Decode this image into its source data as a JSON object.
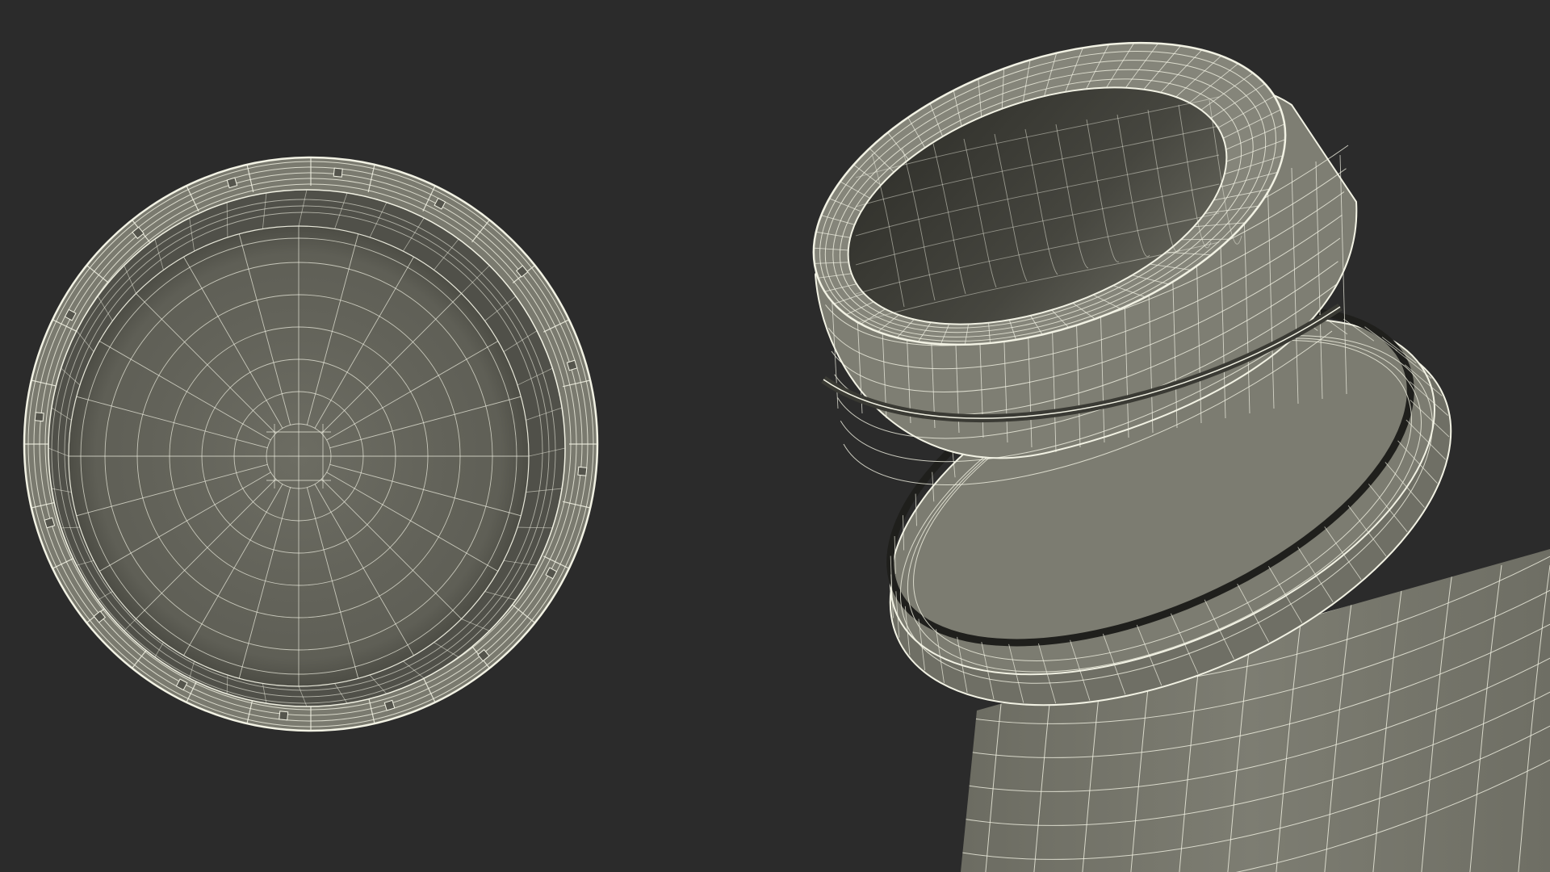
{
  "colors": {
    "background": "#2b2b2b",
    "mesh_fill": "#77776c",
    "mesh_fill_light": "#8a8a7e",
    "mesh_fill_dark": "#4f4f47",
    "interior_dark": "#3a3a34",
    "wire": "#f2f2e4"
  },
  "objects": [
    {
      "name": "bottle-cap-wireframe",
      "view": "underside"
    },
    {
      "name": "bottle-neck-wireframe",
      "view": "angled-top"
    }
  ]
}
